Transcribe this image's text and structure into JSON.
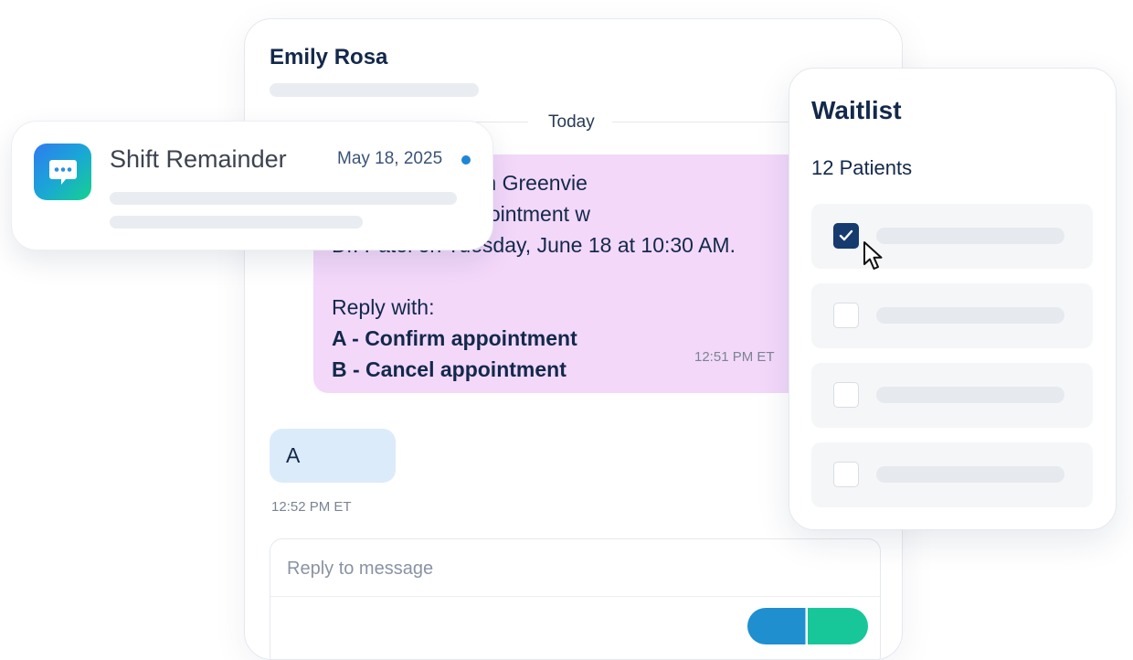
{
  "chat": {
    "contact_name": "Emily Rosa",
    "day_label": "Today",
    "outgoing": {
      "text": "s a reminder from Greenvie\nYou have an appointment w\nDr. Patel on Tuesday, June 18 at 10:30 AM.",
      "reply_label": "Reply with:",
      "option_a": "A - Confirm appointment",
      "option_b": "B - Cancel appointment",
      "time": "12:51 PM ET"
    },
    "incoming": {
      "text": "A",
      "time": "12:52 PM ET"
    },
    "reply": {
      "placeholder": "Reply to message"
    }
  },
  "notification": {
    "title": "Shift Remainder",
    "date": "May 18, 2025",
    "icon": "chat-bubble-icon",
    "accent": "#1f86d6"
  },
  "waitlist": {
    "title": "Waitlist",
    "count": "12 Patients",
    "rows": [
      {
        "checked": true
      },
      {
        "checked": false
      },
      {
        "checked": false
      },
      {
        "checked": false
      }
    ],
    "check_color": "#163b6e"
  }
}
